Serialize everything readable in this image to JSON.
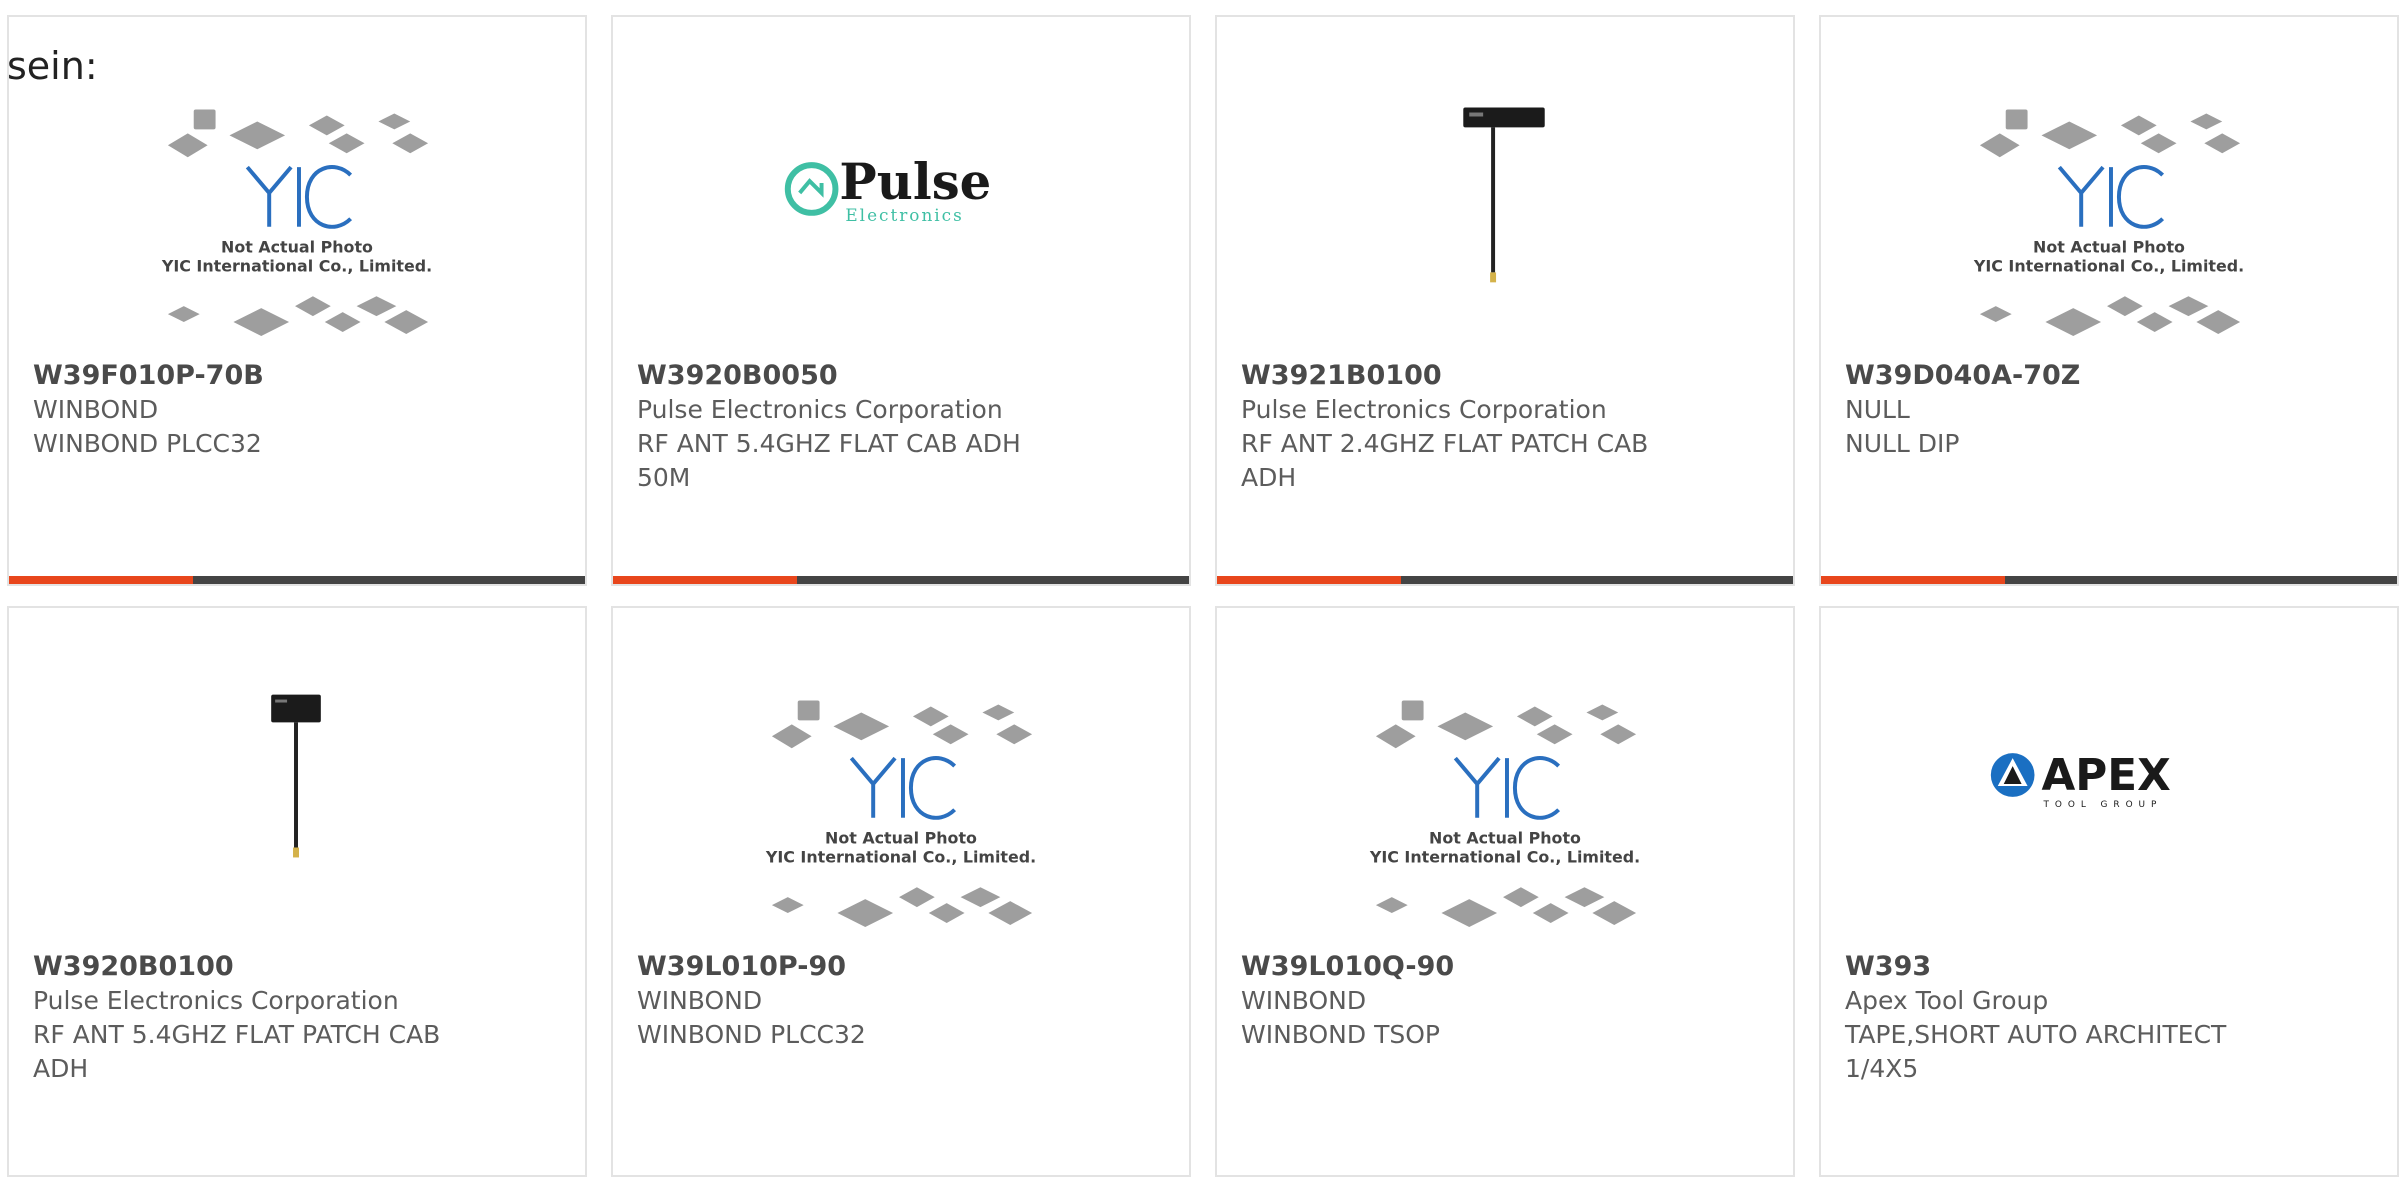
{
  "page": {
    "label": "sein:"
  },
  "colors": {
    "accent_bar": "#e8461c",
    "bar_track": "#444444",
    "card_border": "#e3e3e3"
  },
  "products": [
    {
      "part_no": "W39F010P-70B",
      "manufacturer": "WINBOND",
      "description": "WINBOND PLCC32",
      "image": "yic-placeholder-image",
      "image_text": {
        "line1": "Not Actual Photo",
        "line2": "YIC International Co., Limited."
      }
    },
    {
      "part_no": "W3920B0050",
      "manufacturer": "Pulse Electronics Corporation",
      "description": "RF ANT 5.4GHZ FLAT CAB ADH 50M",
      "image": "pulse-electronics-logo",
      "image_text": {
        "brand": "Pulse",
        "sub": "Electronics"
      }
    },
    {
      "part_no": "W3921B0100",
      "manufacturer": "Pulse Electronics Corporation",
      "description": "RF ANT 2.4GHZ FLAT PATCH CAB ADH",
      "image": "flat-antenna-photo"
    },
    {
      "part_no": "W39D040A-70Z",
      "manufacturer": "NULL",
      "description": "NULL DIP",
      "image": "yic-placeholder-image",
      "image_text": {
        "line1": "Not Actual Photo",
        "line2": "YIC International Co., Limited."
      }
    },
    {
      "part_no": "W3920B0100",
      "manufacturer": "Pulse Electronics Corporation",
      "description": "RF ANT 5.4GHZ FLAT PATCH CAB ADH",
      "image": "flat-antenna-photo"
    },
    {
      "part_no": "W39L010P-90",
      "manufacturer": "WINBOND",
      "description": "WINBOND PLCC32",
      "image": "yic-placeholder-image",
      "image_text": {
        "line1": "Not Actual Photo",
        "line2": "YIC International Co., Limited."
      }
    },
    {
      "part_no": "W39L010Q-90",
      "manufacturer": "WINBOND",
      "description": "WINBOND TSOP",
      "image": "yic-placeholder-image",
      "image_text": {
        "line1": "Not Actual Photo",
        "line2": "YIC International Co., Limited."
      }
    },
    {
      "part_no": "W393",
      "manufacturer": "Apex Tool Group",
      "description": "TAPE,SHORT AUTO ARCHITECT 1/4X5",
      "image": "apex-tool-group-logo",
      "image_text": {
        "brand": "APEX",
        "sub": "TOOL GROUP"
      }
    }
  ]
}
